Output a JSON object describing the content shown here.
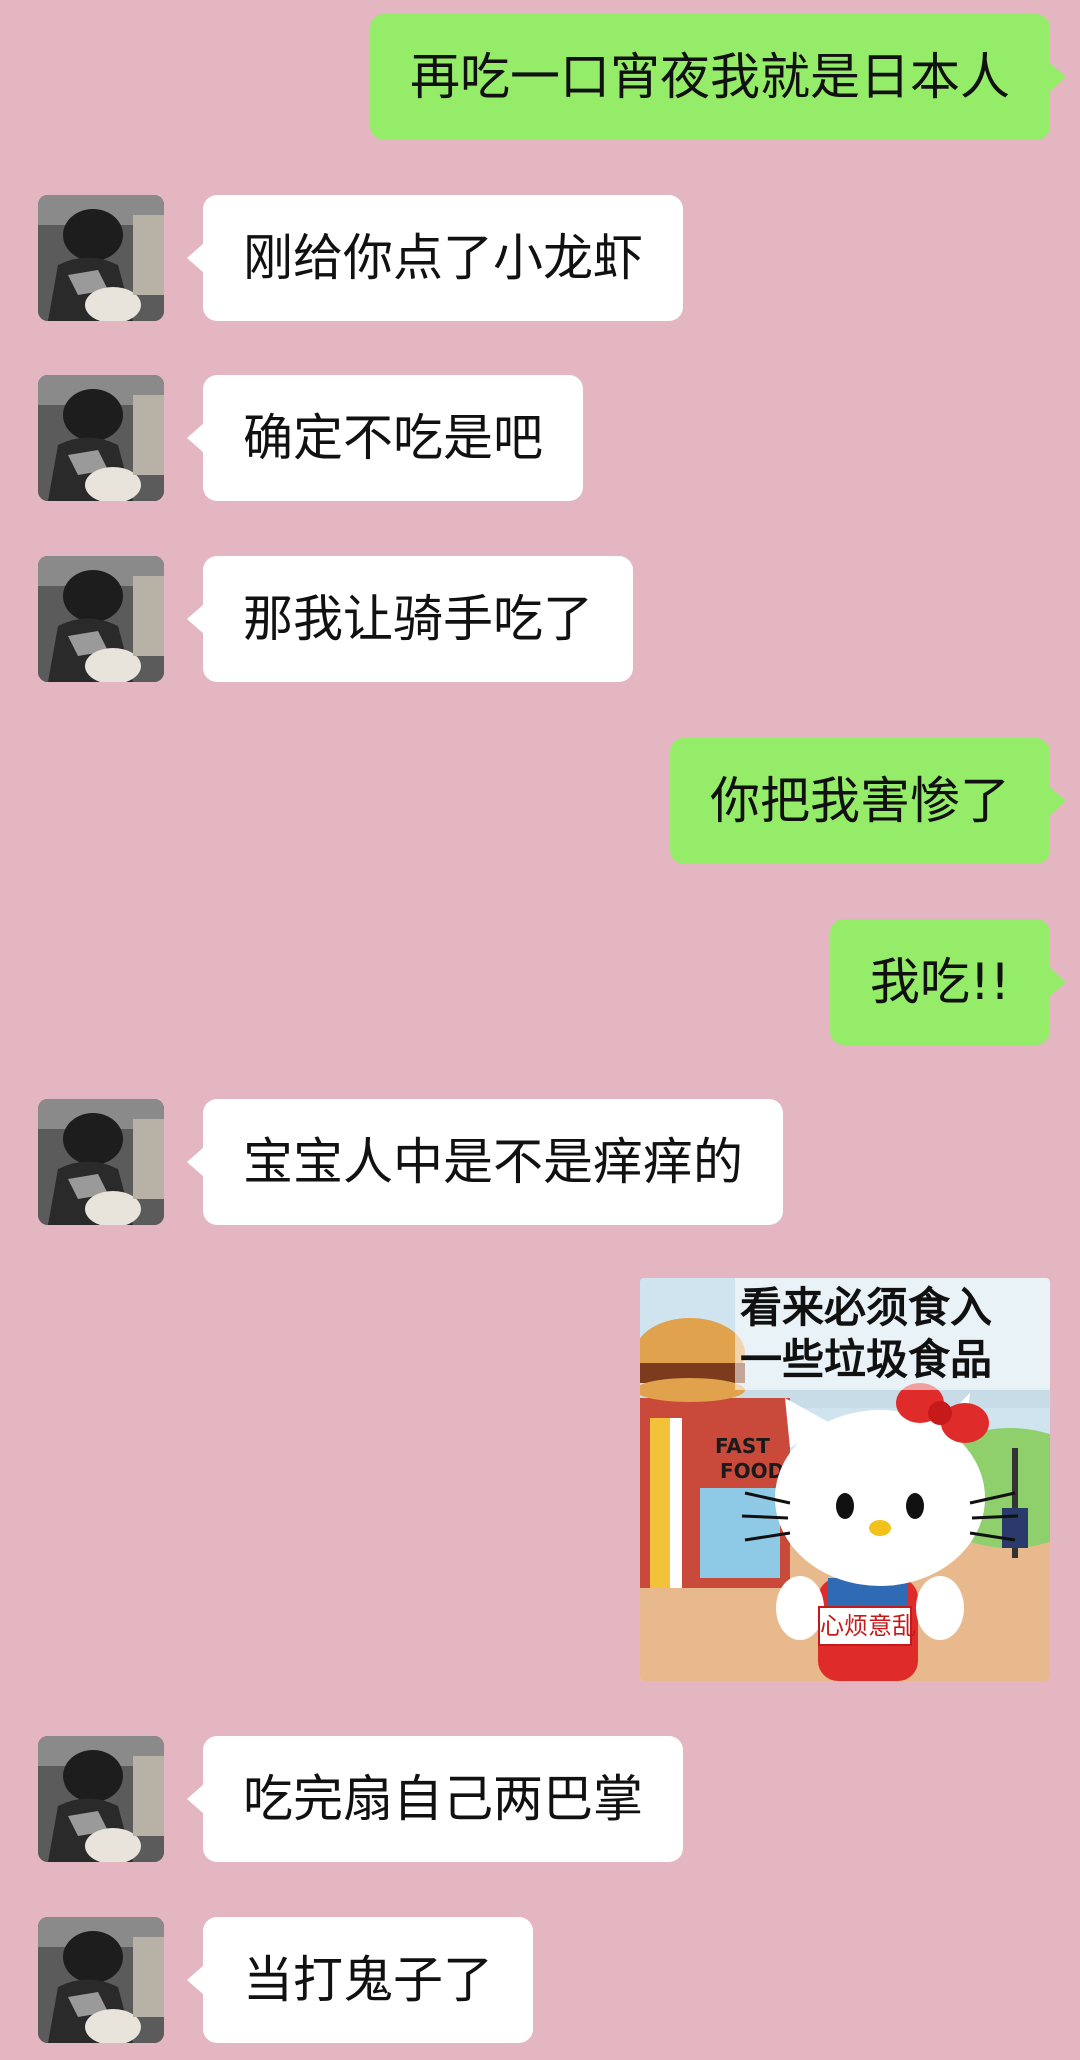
{
  "colors": {
    "background": "#e4b6c2",
    "bubble_self": "#95ec69",
    "bubble_other": "#ffffff"
  },
  "messages": [
    {
      "sender": "self",
      "type": "text",
      "text": "再吃一口宵夜我就是日本人"
    },
    {
      "sender": "other",
      "type": "text",
      "text": "刚给你点了小龙虾"
    },
    {
      "sender": "other",
      "type": "text",
      "text": "确定不吃是吧"
    },
    {
      "sender": "other",
      "type": "text",
      "text": "那我让骑手吃了"
    },
    {
      "sender": "self",
      "type": "text",
      "text": "你把我害惨了"
    },
    {
      "sender": "self",
      "type": "text",
      "text": "我吃!!"
    },
    {
      "sender": "other",
      "type": "text",
      "text": "宝宝人中是不是痒痒的"
    },
    {
      "sender": "self",
      "type": "sticker",
      "caption_line1": "看来必须食入",
      "caption_line2": "一些垃圾食品",
      "sign_text": "心烦意乱",
      "storefront_text": "FAST FOOD"
    },
    {
      "sender": "other",
      "type": "text",
      "text": "吃完扇自己两巴掌"
    },
    {
      "sender": "other",
      "type": "text",
      "text": "当打鬼子了"
    }
  ]
}
